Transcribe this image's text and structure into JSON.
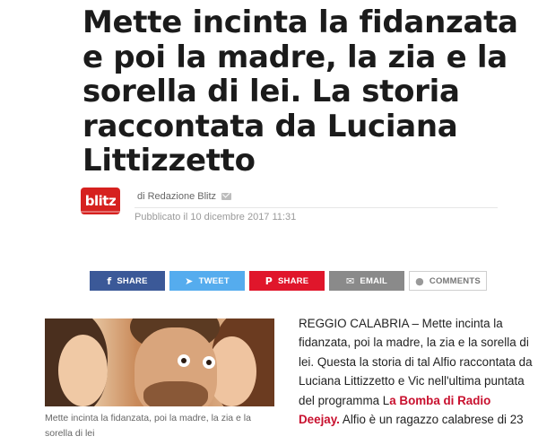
{
  "article": {
    "headline": "Mette incinta la fidanzata e poi la madre, la zia e la sorella di lei. La storia raccontata da Luciana Littizzetto",
    "logo_text": "blitz",
    "byline": "di Redazione Blitz",
    "published": "Pubblicato il 10 dicembre 2017 11:31"
  },
  "share": {
    "facebook": {
      "label": "SHARE",
      "icon": "f"
    },
    "twitter": {
      "label": "TWEET",
      "icon": "🐦"
    },
    "pinterest": {
      "label": "SHARE",
      "icon": "P"
    },
    "email": {
      "label": "EMAIL",
      "icon": "✉"
    },
    "comments": {
      "label": "COMMENTS",
      "icon": "💬"
    }
  },
  "image": {
    "caption": "Mette incinta la fidanzata, poi la madre, la zia e la sorella di lei"
  },
  "body": {
    "text_part1": "REGGIO CALABRIA – Mette incinta la fidanzata, poi la madre, la zia e la sorella di lei. Questa la storia di tal Alfio raccontata da Luciana Littizzetto e Vic nell'ultima puntata del programma L",
    "link_text": "a Bomba di Radio Deejay.",
    "text_part2": " Alfio è un ragazzo calabrese di 23"
  },
  "colors": {
    "facebook": "#3b5998",
    "twitter": "#55acee",
    "pinterest": "#e0162b",
    "email": "#8a8a8a",
    "brand": "#d6211f",
    "link": "#c8102e"
  }
}
